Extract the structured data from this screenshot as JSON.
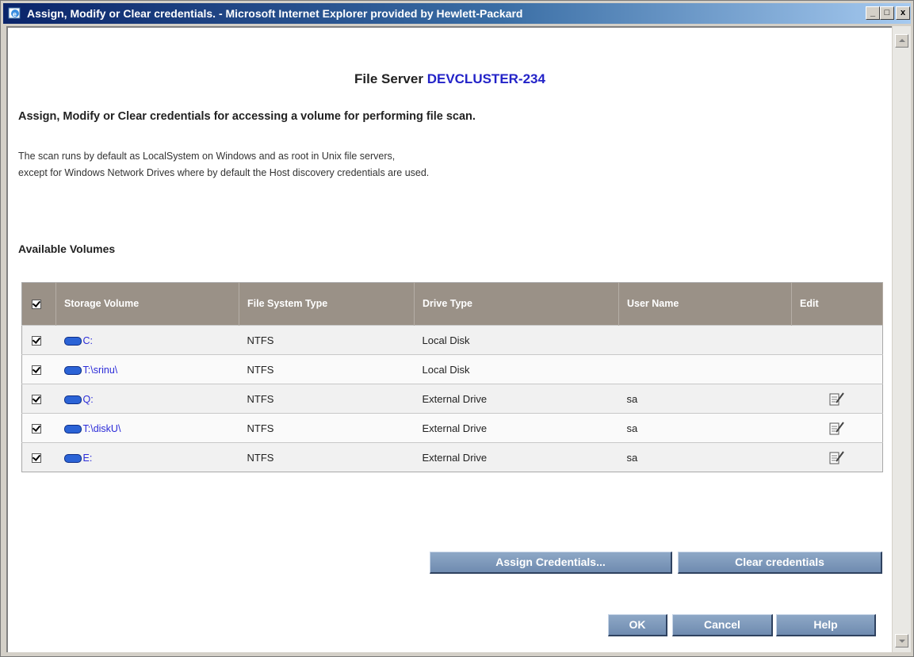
{
  "window": {
    "title": "Assign, Modify or Clear credentials. - Microsoft Internet Explorer provided by Hewlett-Packard",
    "controls": {
      "minimize": "_",
      "maximize": "□",
      "close": "x"
    }
  },
  "header": {
    "prefix": "File Server",
    "server_name": "DEVCLUSTER-234"
  },
  "subhead": "Assign, Modify or Clear credentials for accessing a volume for performing file scan.",
  "info": {
    "line1": "The scan runs by default as LocalSystem on Windows and as root in Unix file servers,",
    "line2": "except for Windows Network Drives where by default the Host discovery credentials are used."
  },
  "section_label": "Available Volumes",
  "table": {
    "columns": {
      "storage_volume": "Storage Volume",
      "file_system_type": "File System Type",
      "drive_type": "Drive Type",
      "user_name": "User Name",
      "edit": "Edit"
    },
    "rows": [
      {
        "volume": "C:",
        "fs": "NTFS",
        "drive": "Local Disk",
        "user": "",
        "editable": false,
        "checked": true
      },
      {
        "volume": "T:\\srinu\\",
        "fs": "NTFS",
        "drive": "Local Disk",
        "user": "",
        "editable": false,
        "checked": true
      },
      {
        "volume": "Q:",
        "fs": "NTFS",
        "drive": "External Drive",
        "user": "sa",
        "editable": true,
        "checked": true
      },
      {
        "volume": "T:\\diskU\\",
        "fs": "NTFS",
        "drive": "External Drive",
        "user": "sa",
        "editable": true,
        "checked": true
      },
      {
        "volume": "E:",
        "fs": "NTFS",
        "drive": "External Drive",
        "user": "sa",
        "editable": true,
        "checked": true
      }
    ]
  },
  "buttons": {
    "assign": "Assign Credentials...",
    "clear": "Clear credentials",
    "ok": "OK",
    "cancel": "Cancel",
    "help": "Help"
  },
  "colors": {
    "server_name": "#2323c8",
    "table_header": "#9a9187",
    "button": "#7a94b8",
    "link": "#2b2bd8"
  }
}
